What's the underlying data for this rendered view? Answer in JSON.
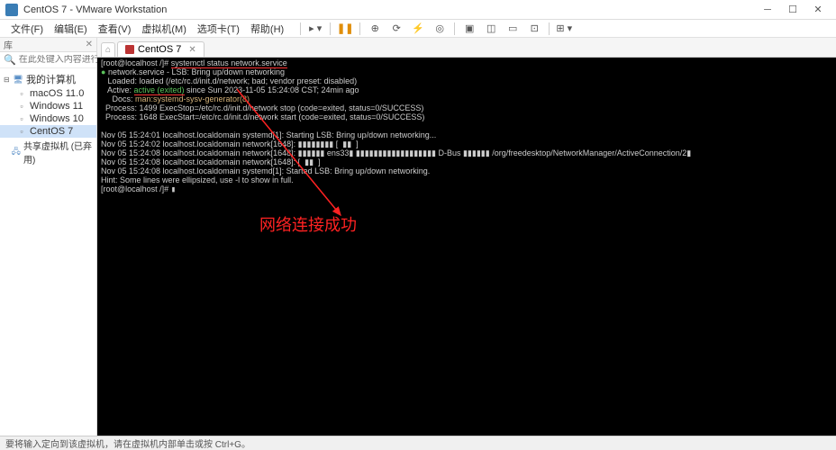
{
  "window": {
    "title": "CentOS 7 - VMware Workstation"
  },
  "menubar": {
    "file": "文件(F)",
    "edit": "编辑(E)",
    "view": "查看(V)",
    "vm": "虚拟机(M)",
    "tabs": "选项卡(T)",
    "help": "帮助(H)"
  },
  "sidebar": {
    "title": "库",
    "search_placeholder": "在此处键入内容进行搜索",
    "root": "我的计算机",
    "items": [
      {
        "label": "macOS 11.0"
      },
      {
        "label": "Windows 11"
      },
      {
        "label": "Windows 10"
      },
      {
        "label": "CentOS 7"
      }
    ],
    "shared": "共享虚拟机 (已弃用)"
  },
  "tabs": {
    "home_icon": "⌂",
    "active": "CentOS 7"
  },
  "terminal": {
    "prompt1": "[root@localhost /]# ",
    "cmd1": "systemctl status network.service",
    "dot": "●",
    "svc_line": " network.service - LSB: Bring up/down networking",
    "loaded": "   Loaded: loaded (/etc/rc.d/init.d/network; bad; vendor preset: disabled)",
    "active_label": "   Active: ",
    "active_val": "active (exited)",
    "active_rest": " since Sun 2023-11-05 15:24:08 CST; 24min ago",
    "docs": "     Docs: ",
    "docs_val": "man:systemd-sysv-generator(8)",
    "proc1": "  Process: 1499 ExecStop=/etc/rc.d/init.d/network stop (code=exited, status=0/SUCCESS)",
    "proc2": "  Process: 1648 ExecStart=/etc/rc.d/init.d/network start (code=exited, status=0/SUCCESS)",
    "blank": "",
    "log1": "Nov 05 15:24:01 localhost.localdomain systemd[1]: Starting LSB: Bring up/down networking...",
    "log2": "Nov 05 15:24:02 localhost.localdomain network[1648]: ▮▮▮▮▮▮▮▮ [  ▮▮  ]",
    "log3": "Nov 05 15:24:08 localhost.localdomain network[1648]: ▮▮▮▮▮▮ ens33▮ ▮▮▮▮▮▮▮▮▮▮▮▮▮▮▮▮▮▮ D-Bus ▮▮▮▮▮▮ /org/freedesktop/NetworkManager/ActiveConnection/2▮",
    "log4": "Nov 05 15:24:08 localhost.localdomain network[1648]: [  ▮▮  ]",
    "log5": "Nov 05 15:24:08 localhost.localdomain systemd[1]: Started LSB: Bring up/down networking.",
    "hint": "Hint: Some lines were ellipsized, use -l to show in full.",
    "prompt2": "[root@localhost /]# "
  },
  "annotation": {
    "text": "网络连接成功"
  },
  "statusbar": {
    "text": "要将输入定向到该虚拟机，请在虚拟机内部单击或按 Ctrl+G。"
  }
}
